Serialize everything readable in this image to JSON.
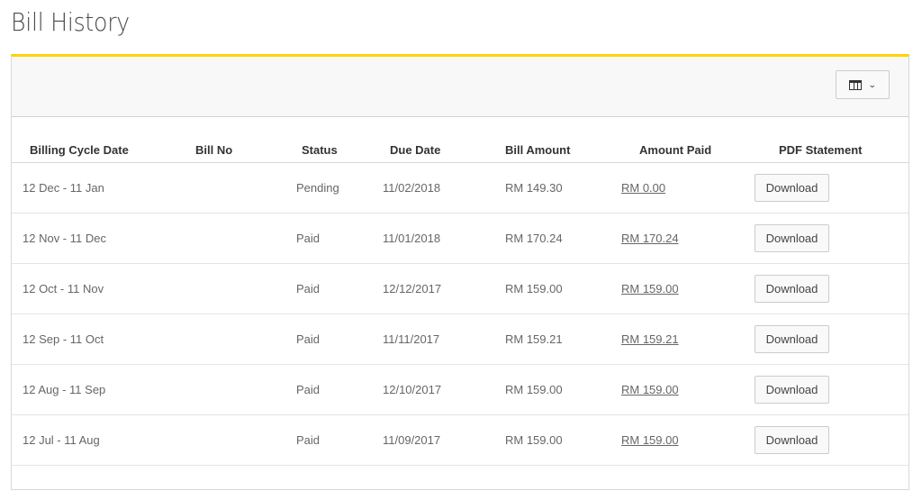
{
  "page": {
    "title": "Bill History"
  },
  "toolbar": {
    "columns_button_icon": "columns-icon",
    "columns_chevron_icon": "chevron-down-icon",
    "chevron_glyph": "⌄"
  },
  "colors": {
    "accent": "#ffd400",
    "toolbar_bg": "#f8f8f8"
  },
  "table": {
    "headers": [
      "Billing Cycle Date",
      "Bill No",
      "Status",
      "Due Date",
      "Bill Amount",
      "Amount Paid",
      "PDF Statement"
    ],
    "rows": [
      {
        "cycle": "12 Dec - 11 Jan",
        "bill_no": "",
        "status": "Pending",
        "due_date": "11/02/2018",
        "bill_amount": "RM 149.30",
        "amount_paid": "RM 0.00",
        "pdf": "Download"
      },
      {
        "cycle": "12 Nov - 11 Dec",
        "bill_no": "",
        "status": "Paid",
        "due_date": "11/01/2018",
        "bill_amount": "RM 170.24",
        "amount_paid": "RM 170.24",
        "pdf": "Download"
      },
      {
        "cycle": "12 Oct - 11 Nov",
        "bill_no": "",
        "status": "Paid",
        "due_date": "12/12/2017",
        "bill_amount": "RM 159.00",
        "amount_paid": "RM 159.00",
        "pdf": "Download"
      },
      {
        "cycle": "12 Sep - 11 Oct",
        "bill_no": "",
        "status": "Paid",
        "due_date": "11/11/2017",
        "bill_amount": "RM 159.21",
        "amount_paid": "RM 159.21",
        "pdf": "Download"
      },
      {
        "cycle": "12 Aug - 11 Sep",
        "bill_no": "",
        "status": "Paid",
        "due_date": "12/10/2017",
        "bill_amount": "RM 159.00",
        "amount_paid": "RM 159.00",
        "pdf": "Download"
      },
      {
        "cycle": "12 Jul - 11 Aug",
        "bill_no": "",
        "status": "Paid",
        "due_date": "11/09/2017",
        "bill_amount": "RM 159.00",
        "amount_paid": "RM 159.00",
        "pdf": "Download"
      }
    ]
  }
}
